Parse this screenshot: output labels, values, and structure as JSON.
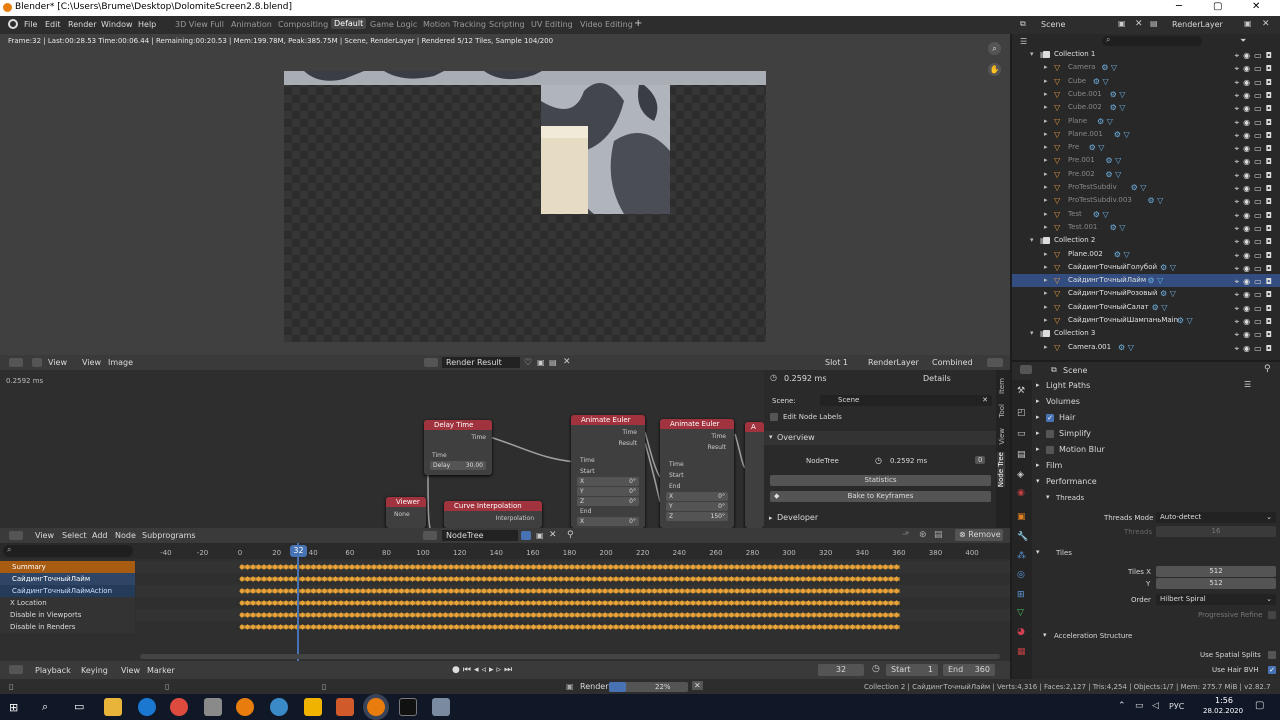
{
  "window": {
    "title": "Blender* [C:\\Users\\Brume\\Desktop\\DolomiteScreen2.8.blend]"
  },
  "menus": [
    "File",
    "Edit",
    "Render",
    "Window",
    "Help"
  ],
  "workspaces": [
    "3D View Full",
    "Animation",
    "Compositing",
    "Default",
    "Game Logic",
    "Motion Tracking",
    "Scripting",
    "UV Editing",
    "Video Editing"
  ],
  "active_workspace": "Default",
  "scene": {
    "name": "Scene",
    "view_layer": "RenderLayer"
  },
  "image_editor": {
    "status": "Frame:32 | Last:00:28.53 Time:00:06.44 | Remaining:00:20.53 | Mem:199.78M, Peak:385.75M | Scene, RenderLayer | Rendered 5/12 Tiles, Sample 104/200",
    "header": {
      "view": "View",
      "view2": "View",
      "image": "Image",
      "image_name": "Render Result",
      "slot": "Slot 1",
      "layer": "RenderLayer",
      "pass": "Combined"
    }
  },
  "node_editor": {
    "time_label": "0.2592 ms",
    "nodes": {
      "delay": {
        "title": "Delay Time",
        "out": "Time",
        "in": "Time",
        "field": "Delay",
        "value": "30.00"
      },
      "viewer": {
        "title": "Viewer",
        "field": "None"
      },
      "curve": {
        "title": "Curve Interpolation",
        "out": "Interpolation"
      },
      "euler1": {
        "title": "Animate Euler",
        "out1": "Time",
        "out2": "Result",
        "in1": "Time",
        "in2": "Start",
        "x": "X",
        "xv": "0°",
        "y": "Y",
        "yv": "0°",
        "z": "Z",
        "zv": "0°",
        "end": "End",
        "x2": "X",
        "x2v": "0°"
      },
      "euler2": {
        "title": "Animate Euler",
        "out1": "Time",
        "out2": "Result",
        "in1": "Time",
        "in2": "Start",
        "in3": "End",
        "x": "X",
        "xv": "0°",
        "y": "Y",
        "yv": "0°",
        "z": "Z",
        "zv": "150°"
      },
      "partial": {
        "title": "A"
      }
    },
    "header": {
      "view": "View",
      "select": "Select",
      "add": "Add",
      "node": "Node",
      "subprograms": "Subprograms",
      "tree": "NodeTree",
      "remove": "Remove"
    }
  },
  "npanel": {
    "time": "0.2592 ms",
    "details": "Details",
    "scene_label": "Scene:",
    "scene_value": "Scene",
    "edit_labels": "Edit Node Labels",
    "overview": "Overview",
    "nodetree": "NodeTree",
    "nodetree_time": "0.2592 ms",
    "nodetree_count": "0",
    "statistics": "Statistics",
    "bake": "Bake to Keyframes",
    "developer": "Developer",
    "tabs": [
      "Item",
      "Tool",
      "View",
      "Node Tree"
    ]
  },
  "timeline": {
    "current_frame": "32",
    "ticks": [
      "-40",
      "-20",
      "0",
      "20",
      "32",
      "40",
      "60",
      "80",
      "100",
      "120",
      "140",
      "160",
      "180",
      "200",
      "220",
      "240",
      "260",
      "280",
      "300",
      "320",
      "340",
      "360",
      "380",
      "400"
    ],
    "channels": [
      {
        "name": "Summary",
        "color": "#a85c12",
        "text": "#fff"
      },
      {
        "name": "СайдингТочныйЛайм",
        "color": "#2e4566",
        "text": "#fff"
      },
      {
        "name": "СайдингТочныйЛаймAction",
        "color": "#243b5a",
        "text": "#cfe0ff"
      },
      {
        "name": "X Location",
        "color": "#333",
        "text": "#ddd"
      },
      {
        "name": "Disable in Viewports",
        "color": "#333",
        "text": "#ddd"
      },
      {
        "name": "Disable in Renders",
        "color": "#333",
        "text": "#ddd"
      }
    ],
    "footer": {
      "playback": "Playback",
      "keying": "Keying",
      "view": "View",
      "marker": "Marker",
      "frame": "32",
      "start_label": "Start",
      "start": "1",
      "end_label": "End",
      "end": "360"
    }
  },
  "outliner": {
    "rows": [
      {
        "name": "Collection 1",
        "type": "collection",
        "indent": 0
      },
      {
        "name": "Camera",
        "type": "object",
        "indent": 1,
        "dim": true
      },
      {
        "name": "Cube",
        "type": "object",
        "indent": 1,
        "dim": true
      },
      {
        "name": "Cube.001",
        "type": "object",
        "indent": 1,
        "dim": true
      },
      {
        "name": "Cube.002",
        "type": "object",
        "indent": 1,
        "dim": true
      },
      {
        "name": "Plane",
        "type": "object",
        "indent": 1,
        "dim": true
      },
      {
        "name": "Plane.001",
        "type": "object",
        "indent": 1,
        "dim": true
      },
      {
        "name": "Pre",
        "type": "object",
        "indent": 1,
        "dim": true
      },
      {
        "name": "Pre.001",
        "type": "object",
        "indent": 1,
        "dim": true
      },
      {
        "name": "Pre.002",
        "type": "object",
        "indent": 1,
        "dim": true
      },
      {
        "name": "ProTestSubdiv",
        "type": "object",
        "indent": 1,
        "dim": true
      },
      {
        "name": "ProTestSubdiv.003",
        "type": "object",
        "indent": 1,
        "dim": true
      },
      {
        "name": "Test",
        "type": "object",
        "indent": 1,
        "dim": true
      },
      {
        "name": "Test.001",
        "type": "object",
        "indent": 1,
        "dim": true
      },
      {
        "name": "Collection 2",
        "type": "collection",
        "indent": 0
      },
      {
        "name": "Plane.002",
        "type": "object",
        "indent": 1
      },
      {
        "name": "СайдингТочныйГолубой",
        "type": "object",
        "indent": 1
      },
      {
        "name": "СайдингТочныйЛайм",
        "type": "object",
        "indent": 1,
        "selected": true
      },
      {
        "name": "СайдингТочныйРозовый",
        "type": "object",
        "indent": 1
      },
      {
        "name": "СайдингТочныйСалат",
        "type": "object",
        "indent": 1
      },
      {
        "name": "СайдингТочныйШампаньMain",
        "type": "object",
        "indent": 1
      },
      {
        "name": "Collection 3",
        "type": "collection",
        "indent": 0
      },
      {
        "name": "Camera.001",
        "type": "object",
        "indent": 1
      }
    ]
  },
  "properties": {
    "scene": "Scene",
    "sections": {
      "light_paths": "Light Paths",
      "volumes": "Volumes",
      "hair": "Hair",
      "simplify": "Simplify",
      "motion_blur": "Motion Blur",
      "film": "Film",
      "performance": "Performance",
      "threads": "Threads",
      "tiles": "Tiles",
      "accel": "Acceleration Structure"
    },
    "threads_mode_label": "Threads Mode",
    "threads_mode": "Auto-detect",
    "threads_label": "Threads",
    "threads": "16",
    "tiles_x_label": "Tiles X",
    "tiles_x": "512",
    "tiles_y_label": "Y",
    "tiles_y": "512",
    "order_label": "Order",
    "order": "Hilbert Spiral",
    "progressive": "Progressive Refine",
    "spatial": "Use Spatial Splits",
    "hair_bvh": "Use Hair BVH"
  },
  "statusbar": {
    "render_label": "Render",
    "progress": "22%",
    "progress_value": 0.22,
    "info": "Collection 2 | СайдингТочныйЛайм | Verts:4,316 | Faces:2,127 | Tris:4,254 | Objects:1/7 | Mem: 275.7 MiB | v2.82.7"
  },
  "taskbar": {
    "lang": "РУС",
    "time": "1:56",
    "date": "28.02.2020"
  }
}
